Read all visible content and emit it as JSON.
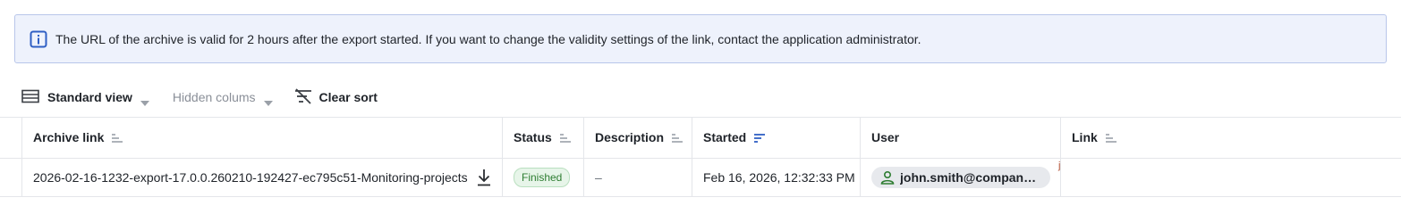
{
  "banner": {
    "icon": "info-icon",
    "message": "The URL of the archive is valid for 2 hours after the export started. If you want to change the validity settings of the link, contact the application administrator."
  },
  "toolbar": {
    "standard_view": {
      "label": "Standard view",
      "icon": "table-view-icon"
    },
    "hidden_columns": {
      "label": "Hidden colums"
    },
    "clear_sort": {
      "label": "Clear sort",
      "icon": "clear-sort-icon"
    }
  },
  "table": {
    "columns": [
      {
        "label": "Archive link",
        "sort": "none"
      },
      {
        "label": "Status",
        "sort": "none"
      },
      {
        "label": "Description",
        "sort": "none"
      },
      {
        "label": "Started",
        "sort": "active"
      },
      {
        "label": "User",
        "sort": "none"
      },
      {
        "label": "Link",
        "sort": "none"
      }
    ],
    "rows": [
      {
        "archive_link": "2026-02-16-1232-export-17.0.0.260210-192427-ec795c51-Monitoring-projects",
        "status": "Finished",
        "description": "–",
        "started": "Feb 16, 2026, 12:32:33 PM",
        "user": "john.smith@company.c...",
        "link_fragment": "j"
      }
    ]
  },
  "colors": {
    "accent": "#2f5fc4",
    "banner_bg": "#eef2fc",
    "banner_border": "#b8c6ea",
    "status_finished": "#2e7d32"
  }
}
